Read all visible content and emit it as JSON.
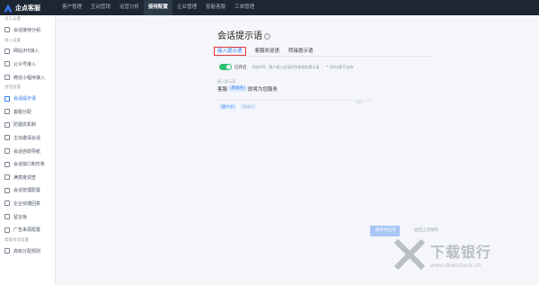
{
  "brand": {
    "name": "企点客服"
  },
  "nav": {
    "items": [
      "客户管理",
      "互动营销",
      "运营分析",
      "接待配置",
      "企业管理",
      "智能客服",
      "工单管理"
    ],
    "active_index": 3
  },
  "sidebar": {
    "groups": [
      {
        "title": "员工设置",
        "items": [
          {
            "label": "会话接待分组",
            "active": false
          }
        ]
      },
      {
        "title": "接入设置",
        "items": [
          {
            "label": "网站/H5接入"
          },
          {
            "label": "公众号接入"
          },
          {
            "label": "微信小程序接入"
          }
        ]
      },
      {
        "title": "会话设置",
        "items": [
          {
            "label": "会话提示语",
            "active": true
          },
          {
            "label": "客服分配"
          },
          {
            "label": "防骚扰机制"
          },
          {
            "label": "主动邀请会话"
          },
          {
            "label": "会话自助导航"
          },
          {
            "label": "会话窗口和形象"
          },
          {
            "label": "满意度调查"
          },
          {
            "label": "会话管理配置"
          },
          {
            "label": "企业快捷回复"
          },
          {
            "label": "留言板"
          },
          {
            "label": "广告来源配置"
          }
        ]
      },
      {
        "title": "高级会话设置",
        "items": [
          {
            "label": "高级分配规则"
          }
        ]
      }
    ]
  },
  "main": {
    "title": "会话提示语",
    "tabs": [
      "接入提示语",
      "客服欢迎语",
      "转接提示语"
    ],
    "active_tab": 0,
    "toggle": {
      "label": "已开启",
      "description": "网站/H5、客户接入会话时所使用的提示语",
      "note": "* QQ访客不支持"
    },
    "editor": {
      "label": "接入提示语",
      "text_before": "客服",
      "placeholder": "[客服名]",
      "text_after": "即将为您服务",
      "counter": "9/40",
      "var_buttons": [
        "[客户名]",
        "[客服名]"
      ]
    },
    "save_label": "保存并应用",
    "reset_label": "返回上次保存"
  },
  "watermark": {
    "text": "下载银行",
    "url": "www.downbank.cn"
  }
}
